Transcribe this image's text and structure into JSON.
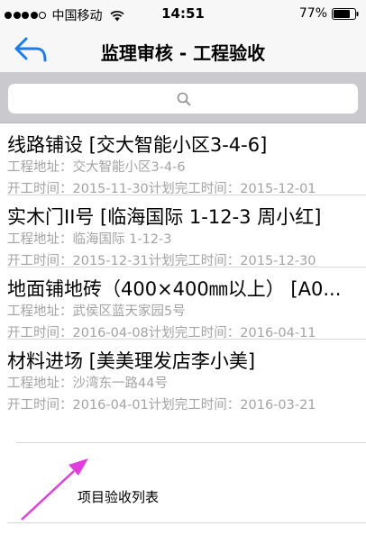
{
  "status_bar": {
    "carrier": "中国移动",
    "time": "14:51",
    "battery": "77%"
  },
  "nav": {
    "back_icon": "back-arrow-icon",
    "title": "监理审核 - 工程验收"
  },
  "search": {
    "placeholder": "",
    "icon": "search-icon"
  },
  "items": [
    {
      "title": "线路铺设 [交大智能小区3-4-6]",
      "address": "工程地址：交大智能小区3-4-6",
      "dates": "开工时间：2015-11-30计划完工时间：2015-12-01"
    },
    {
      "title": "实木门II号 [临海国际 1-12-3 周小红]",
      "address": "工程地址：临海国际 1-12-3",
      "dates": "开工时间：2015-12-31计划完工时间：2015-12-30"
    },
    {
      "title": "地面铺地砖（400×400㎜以上） [A0...",
      "address": "工程地址：武侯区蓝天家园5号",
      "dates": "开工时间：2016-04-08计划完工时间：2016-04-11"
    },
    {
      "title": "材料进场 [美美理发店李小美]",
      "address": "工程地址：沙湾东一路44号",
      "dates": "开工时间：2016-04-01计划完工时间：2016-03-21"
    }
  ],
  "annotation": {
    "label": "项目验收列表",
    "color": "#e23ce0"
  },
  "colors": {
    "accent": "#1a7cf5",
    "secondary_text": "#a3a3a3",
    "search_bar_bg": "#cacace"
  }
}
